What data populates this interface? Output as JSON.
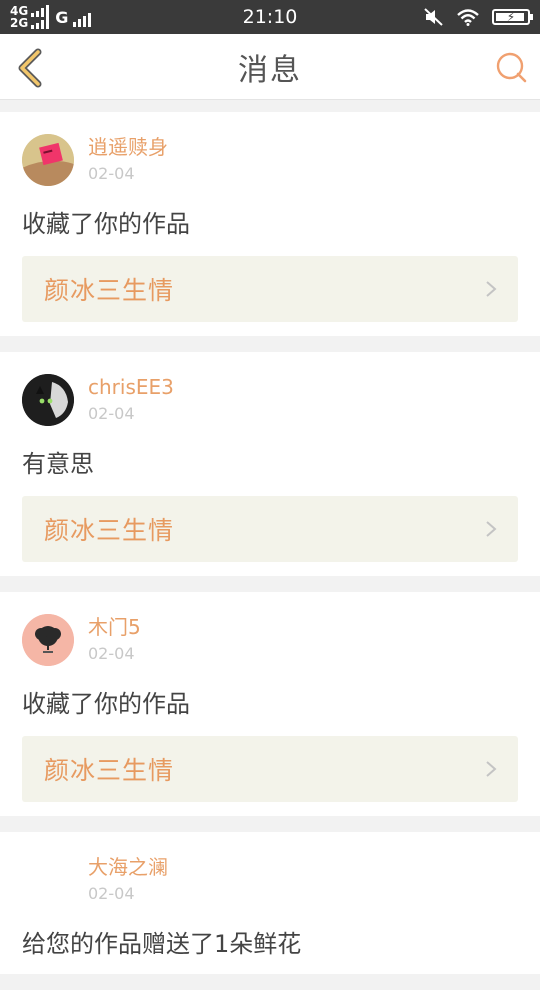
{
  "status_bar": {
    "net_top": "4G",
    "net_bottom": "2G",
    "carrier_g": "G",
    "time": "21:10",
    "battery_bolt": "⚡"
  },
  "nav": {
    "title": "消息",
    "accent": "#f2c66a",
    "search_color": "#f0a070"
  },
  "messages": [
    {
      "username": "逍遥赎身",
      "date": "02-04",
      "text": "收藏了你的作品",
      "work_title": "颜冰三生情",
      "avatar": "pink-note-avatar"
    },
    {
      "username": "chrisEE3",
      "date": "02-04",
      "text": "有意思",
      "work_title": "颜冰三生情",
      "avatar": "black-cat-avatar"
    },
    {
      "username": "木门5",
      "date": "02-04",
      "text": "收藏了你的作品",
      "work_title": "颜冰三生情",
      "avatar": "tree-avatar"
    },
    {
      "username": "大海之澜",
      "date": "02-04",
      "text": "给您的作品赠送了1朵鲜花",
      "avatar": "blank-avatar"
    }
  ],
  "colors": {
    "username": "#e8a069",
    "work_title": "#e79a60",
    "work_bg": "#f3f3ea"
  }
}
